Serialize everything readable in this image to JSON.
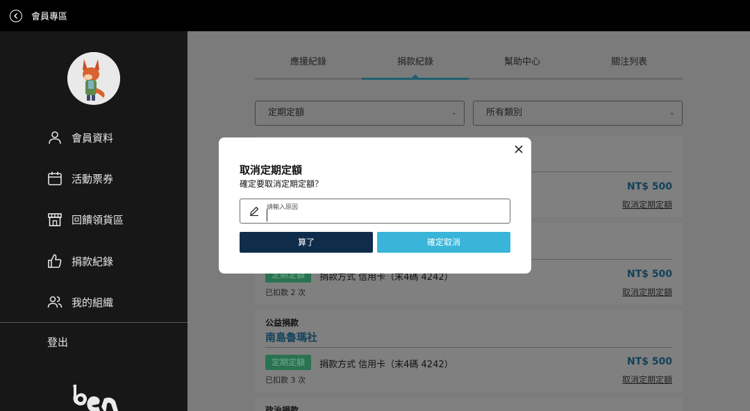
{
  "topbar": {
    "title": "會員專區"
  },
  "sidebar": {
    "items": [
      {
        "label": "會員資料",
        "icon": "user-icon"
      },
      {
        "label": "活動票券",
        "icon": "calendar-icon"
      },
      {
        "label": "回饋領貨區",
        "icon": "store-icon"
      },
      {
        "label": "捐款紀錄",
        "icon": "thumbs-up-icon"
      },
      {
        "label": "我的組織",
        "icon": "users-icon"
      }
    ],
    "logout_label": "登出"
  },
  "tabs": [
    {
      "label": "應援紀錄"
    },
    {
      "label": "捐款紀錄",
      "active": true
    },
    {
      "label": "幫助中心"
    },
    {
      "label": "關注列表"
    }
  ],
  "filters": {
    "frequency": "定期定額",
    "category": "所有類別"
  },
  "records": [
    {
      "amount": "NT$ 500",
      "cancel_label": "取消定期定額"
    },
    {
      "badge": "定期定額",
      "pay_method": "捐款方式 信用卡（末4碼 4242）",
      "deducted": "已扣款 2 次",
      "amount": "NT$ 500",
      "cancel_label": "取消定期定額"
    },
    {
      "type": "公益捐款",
      "org": "南島魯瑪社",
      "badge": "定期定額",
      "pay_method": "捐款方式 信用卡（末4碼 4242）",
      "deducted": "已扣款 3 次",
      "amount": "NT$ 500",
      "cancel_label": "取消定期定額"
    },
    {
      "type": "政治捐款"
    }
  ],
  "modal": {
    "title": "取消定期定額",
    "subtitle": "確定要取消定期定額？",
    "reason_placeholder": "請輸入原因",
    "cancel_button": "算了",
    "confirm_button": "確定取消"
  },
  "colors": {
    "accent": "#38b5d8",
    "primary_dark": "#0f2d4a",
    "badge_green": "#2a7350"
  }
}
